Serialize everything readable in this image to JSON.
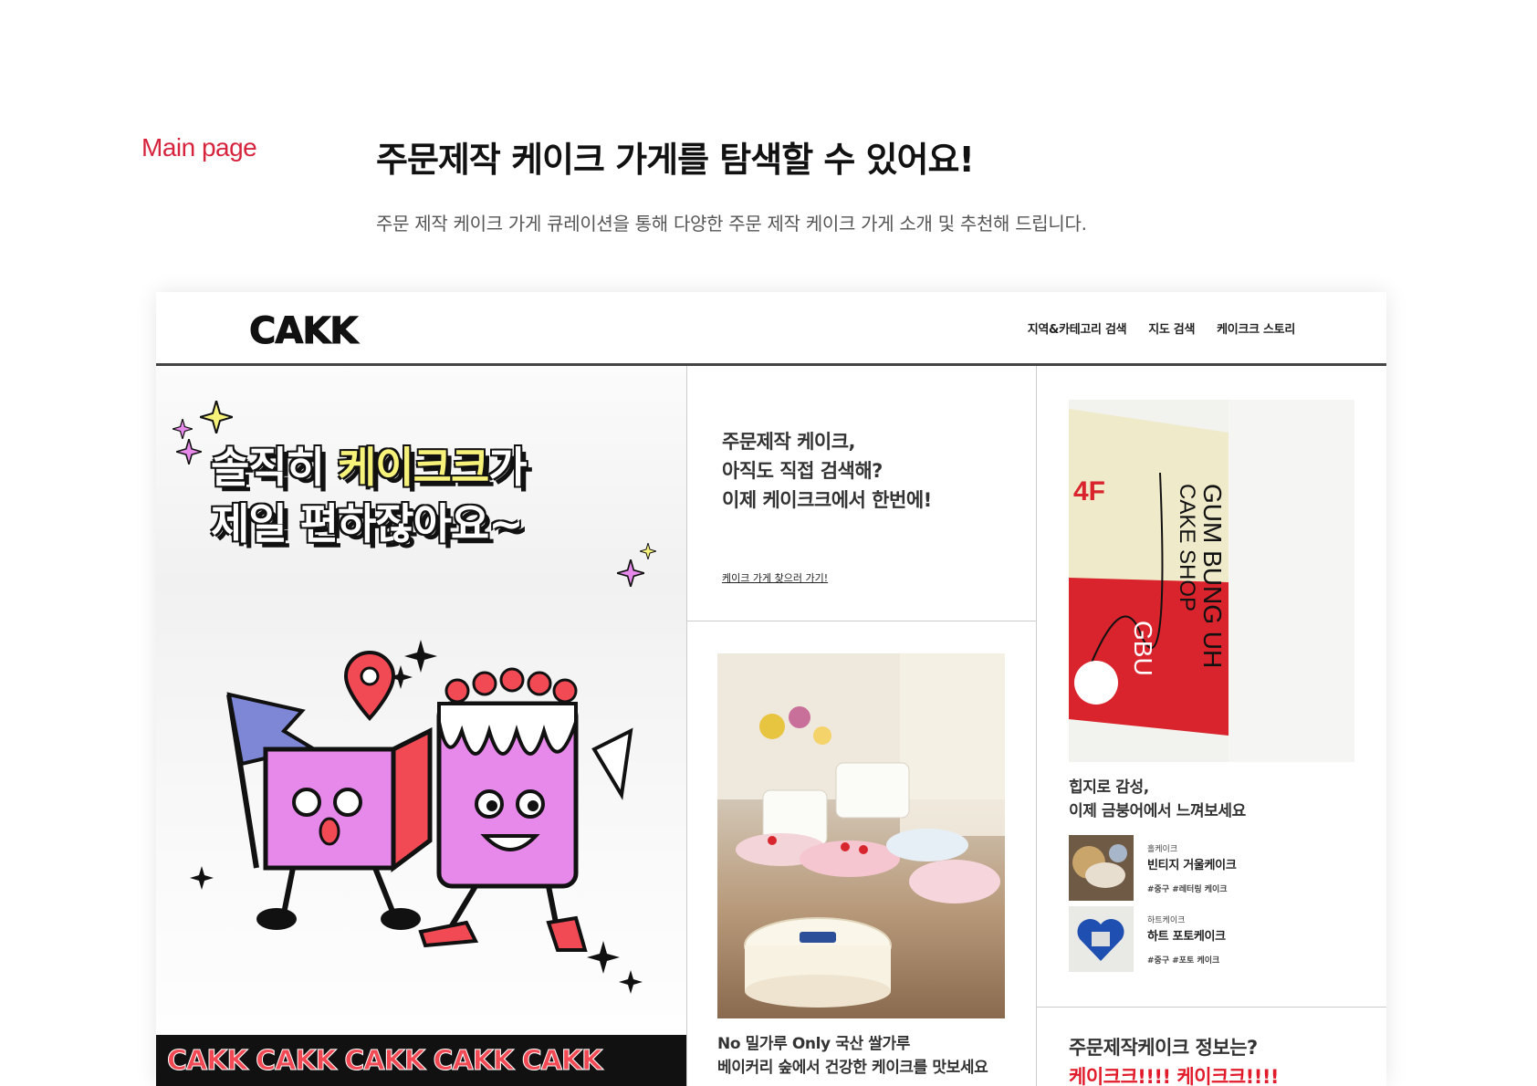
{
  "section_label": "Main page",
  "title": "주문제작 케이크 가게를 탐색할 수 있어요!",
  "subtitle": "주문 제작 케이크 가게 큐레이션을 통해 다양한 주문 제작 케이크 가게 소개 및 추천해 드립니다.",
  "site": {
    "logo": "CAKK",
    "nav": [
      "지역&카테고리 검색",
      "지도 검색",
      "케이크크 스토리"
    ],
    "hero": {
      "line1_a": "솔직히 ",
      "line1_b": "케이크크",
      "line1_c": "가",
      "line2": "제일 편하잖아요~",
      "ticker": "CAKK CAKK CAKK CAKK CAKK"
    },
    "promo": {
      "lines": [
        "주문제작 케이크,",
        "아직도 직접 검색해?",
        "이제 케이크크에서 한번에!"
      ],
      "link": "케이크 가게 찾으러 가기!"
    },
    "cakes_caption": [
      "No 밀가루 Only 국산 쌀가루",
      "베이커리 숲에서 건강한 케이크를 맛보세요"
    ],
    "poster": {
      "floor": "4F",
      "line1": "GUM BUNG UH",
      "line2": "CAKE SHOP",
      "short": "GBU"
    },
    "poster_caption": [
      "힙지로 감성,",
      "이제 금붕어에서 느껴보세요"
    ],
    "items": [
      {
        "category": "홀케이크",
        "name": "빈티지 거울케이크",
        "tags": "#중구  #레터링 케이크"
      },
      {
        "category": "하트케이크",
        "name": "하트 포토케이크",
        "tags": "#중구  #포토 케이크"
      }
    ],
    "info_title": "주문제작케이크 정보는?",
    "info_red": "케이크크!!!! 케이크크!!!!"
  },
  "colors": {
    "accent_red": "#d6243d",
    "pink": "#e789ea",
    "yellow": "#f7f27a",
    "purple": "#7e86d6"
  }
}
